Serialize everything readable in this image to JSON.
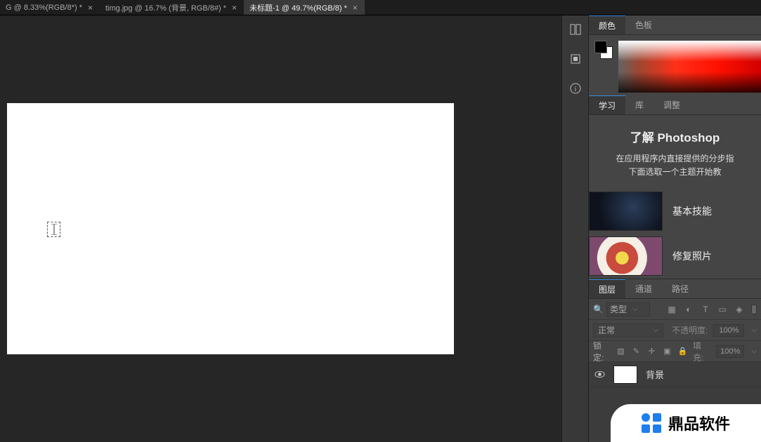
{
  "docTabs": [
    {
      "label": "G @ 8.33%(RGB/8*) *",
      "active": false
    },
    {
      "label": "timg.jpg @ 16.7% (背景, RGB/8#) *",
      "active": false
    },
    {
      "label": "未标题-1 @ 49.7%(RGB/8) *",
      "active": true
    }
  ],
  "colorPanel": {
    "tabs": [
      "颜色",
      "色板"
    ],
    "activeTab": 0
  },
  "learnPanel": {
    "tabs": [
      "学习",
      "库",
      "调整"
    ],
    "activeTab": 0,
    "title": "了解 Photoshop",
    "subtitle1": "在应用程序内直接提供的分步指",
    "subtitle2": "下面选取一个主题开始教",
    "items": [
      {
        "label": "基本技能",
        "thumb": "dark"
      },
      {
        "label": "修复照片",
        "thumb": "flower"
      }
    ]
  },
  "layersPanel": {
    "tabs": [
      "图层",
      "通道",
      "路径"
    ],
    "activeTab": 0,
    "filterLabel": "类型",
    "blendMode": "正常",
    "opacityLabel": "不透明度:",
    "opacityValue": "100%",
    "lockLabel": "锁定:",
    "fillLabel": "填充:",
    "fillValue": "100%",
    "layers": [
      {
        "name": "背景"
      }
    ]
  },
  "watermark": {
    "text": "鼎品软件"
  }
}
